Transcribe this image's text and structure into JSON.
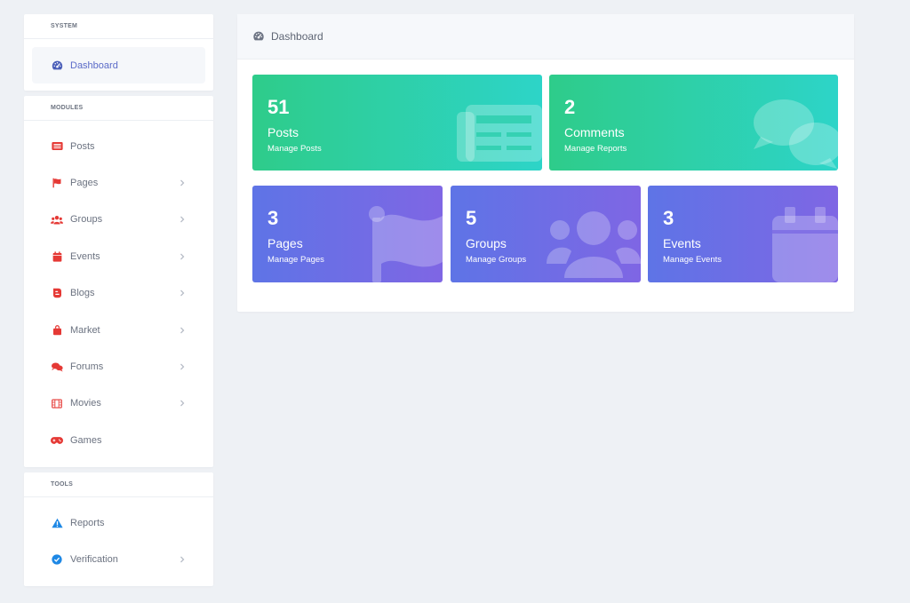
{
  "sidebar": {
    "system": {
      "title": "SYSTEM",
      "items": [
        {
          "label": "Dashboard",
          "icon": "gauge-icon"
        }
      ]
    },
    "modules": {
      "title": "MODULES",
      "items": [
        {
          "label": "Posts",
          "icon": "newspaper-icon"
        },
        {
          "label": "Pages",
          "icon": "flag-icon"
        },
        {
          "label": "Groups",
          "icon": "users-icon"
        },
        {
          "label": "Events",
          "icon": "calendar-icon"
        },
        {
          "label": "Blogs",
          "icon": "blog-icon"
        },
        {
          "label": "Market",
          "icon": "shopping-bag-icon"
        },
        {
          "label": "Forums",
          "icon": "comments-icon"
        },
        {
          "label": "Movies",
          "icon": "film-icon"
        },
        {
          "label": "Games",
          "icon": "gamepad-icon"
        }
      ]
    },
    "tools": {
      "title": "TOOLS",
      "items": [
        {
          "label": "Reports",
          "icon": "warning-icon"
        },
        {
          "label": "Verification",
          "icon": "check-circle-icon"
        }
      ]
    }
  },
  "main": {
    "header": {
      "title": "Dashboard",
      "icon": "gauge-icon"
    },
    "cards": [
      {
        "count": "51",
        "title": "Posts",
        "subtitle": "Manage Posts",
        "icon": "newspaper-icon"
      },
      {
        "count": "2",
        "title": "Comments",
        "subtitle": "Manage Reports",
        "icon": "comments-icon"
      },
      {
        "count": "3",
        "title": "Pages",
        "subtitle": "Manage Pages",
        "icon": "flag-icon"
      },
      {
        "count": "5",
        "title": "Groups",
        "subtitle": "Manage Groups",
        "icon": "users-icon"
      },
      {
        "count": "3",
        "title": "Events",
        "subtitle": "Manage Events",
        "icon": "calendar-icon"
      }
    ]
  },
  "colors": {
    "background": "#eef1f5",
    "active_text": "#5b6bc8",
    "module_icon": "#e53935",
    "tool_icon": "#1e88e5",
    "green_start": "#2ecc8a",
    "green_end": "#2dd4c8",
    "purple_start": "#5e74e6",
    "purple_end": "#7f66e4"
  }
}
